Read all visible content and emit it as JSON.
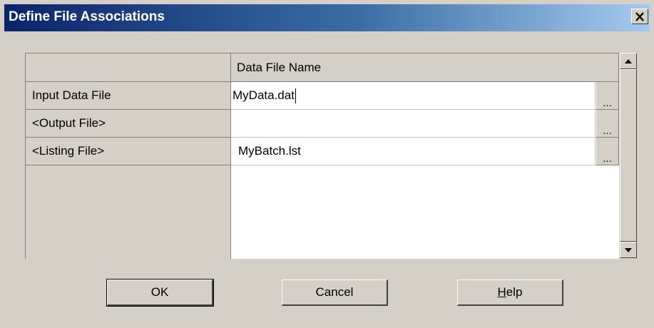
{
  "window": {
    "title": "Define File Associations",
    "close_glyph": "×"
  },
  "grid": {
    "header": {
      "corner": "",
      "column": "Data File Name"
    },
    "rows": [
      {
        "label": "Input Data File",
        "value": "MyData.dat",
        "browse": "..."
      },
      {
        "label": "<Output File>",
        "value": "",
        "browse": "..."
      },
      {
        "label": "<Listing File>",
        "value": "MyBatch.lst",
        "browse": "..."
      }
    ]
  },
  "scrollbar": {
    "up_icon": "triangle-up",
    "down_icon": "triangle-down"
  },
  "buttons": {
    "ok": "OK",
    "cancel": "Cancel",
    "help_mnemonic": "H",
    "help_rest": "elp"
  },
  "colors": {
    "titlebar_start": "#0a246a",
    "titlebar_end": "#a6caf0",
    "face": "#d4d0c8"
  }
}
